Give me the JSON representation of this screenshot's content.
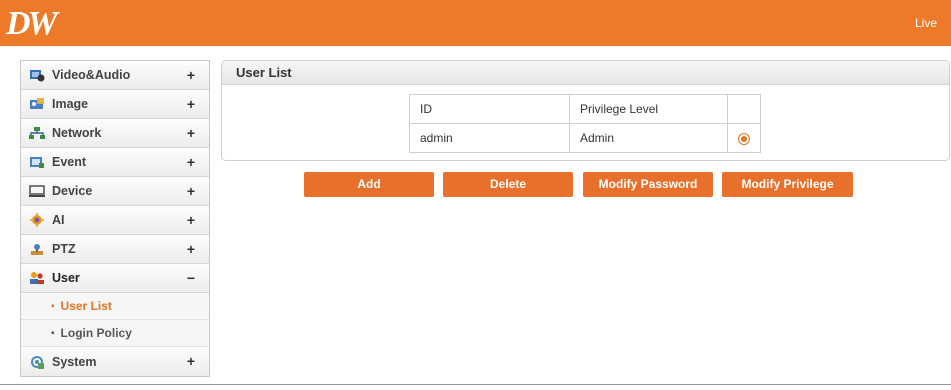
{
  "header": {
    "logo": "DW",
    "live_label": "Live"
  },
  "sidebar": {
    "items": [
      {
        "label": "Video&Audio",
        "toggle": "+",
        "icon": "video-audio-icon",
        "color": "#3a6fb5"
      },
      {
        "label": "Image",
        "toggle": "+",
        "icon": "image-icon",
        "color": "#d9a13b"
      },
      {
        "label": "Network",
        "toggle": "+",
        "icon": "network-icon",
        "color": "#3f8a3f"
      },
      {
        "label": "Event",
        "toggle": "+",
        "icon": "event-icon",
        "color": "#4a7fc1"
      },
      {
        "label": "Device",
        "toggle": "+",
        "icon": "device-icon",
        "color": "#444444"
      },
      {
        "label": "AI",
        "toggle": "+",
        "icon": "ai-icon",
        "color": "#e0a020"
      },
      {
        "label": "PTZ",
        "toggle": "+",
        "icon": "ptz-icon",
        "color": "#c98a3a"
      },
      {
        "label": "User",
        "toggle": "−",
        "icon": "user-icon",
        "color": "#c0392b",
        "expanded": true,
        "subitems": [
          {
            "label": "User List",
            "selected": true
          },
          {
            "label": "Login Policy",
            "selected": false
          }
        ]
      },
      {
        "label": "System",
        "toggle": "+",
        "icon": "system-icon",
        "color": "#4a8ac0"
      }
    ]
  },
  "main": {
    "panel_title": "User List",
    "table": {
      "headers": [
        "ID",
        "Privilege Level",
        ""
      ],
      "rows": [
        {
          "id": "admin",
          "privilege": "Admin",
          "selected": true
        }
      ]
    },
    "buttons": {
      "add": "Add",
      "delete": "Delete",
      "modify_password": "Modify Password",
      "modify_privilege": "Modify Privilege"
    }
  },
  "colors": {
    "accent": "#ec7a28",
    "button": "#e8702a",
    "selected_text": "#e5731f"
  }
}
